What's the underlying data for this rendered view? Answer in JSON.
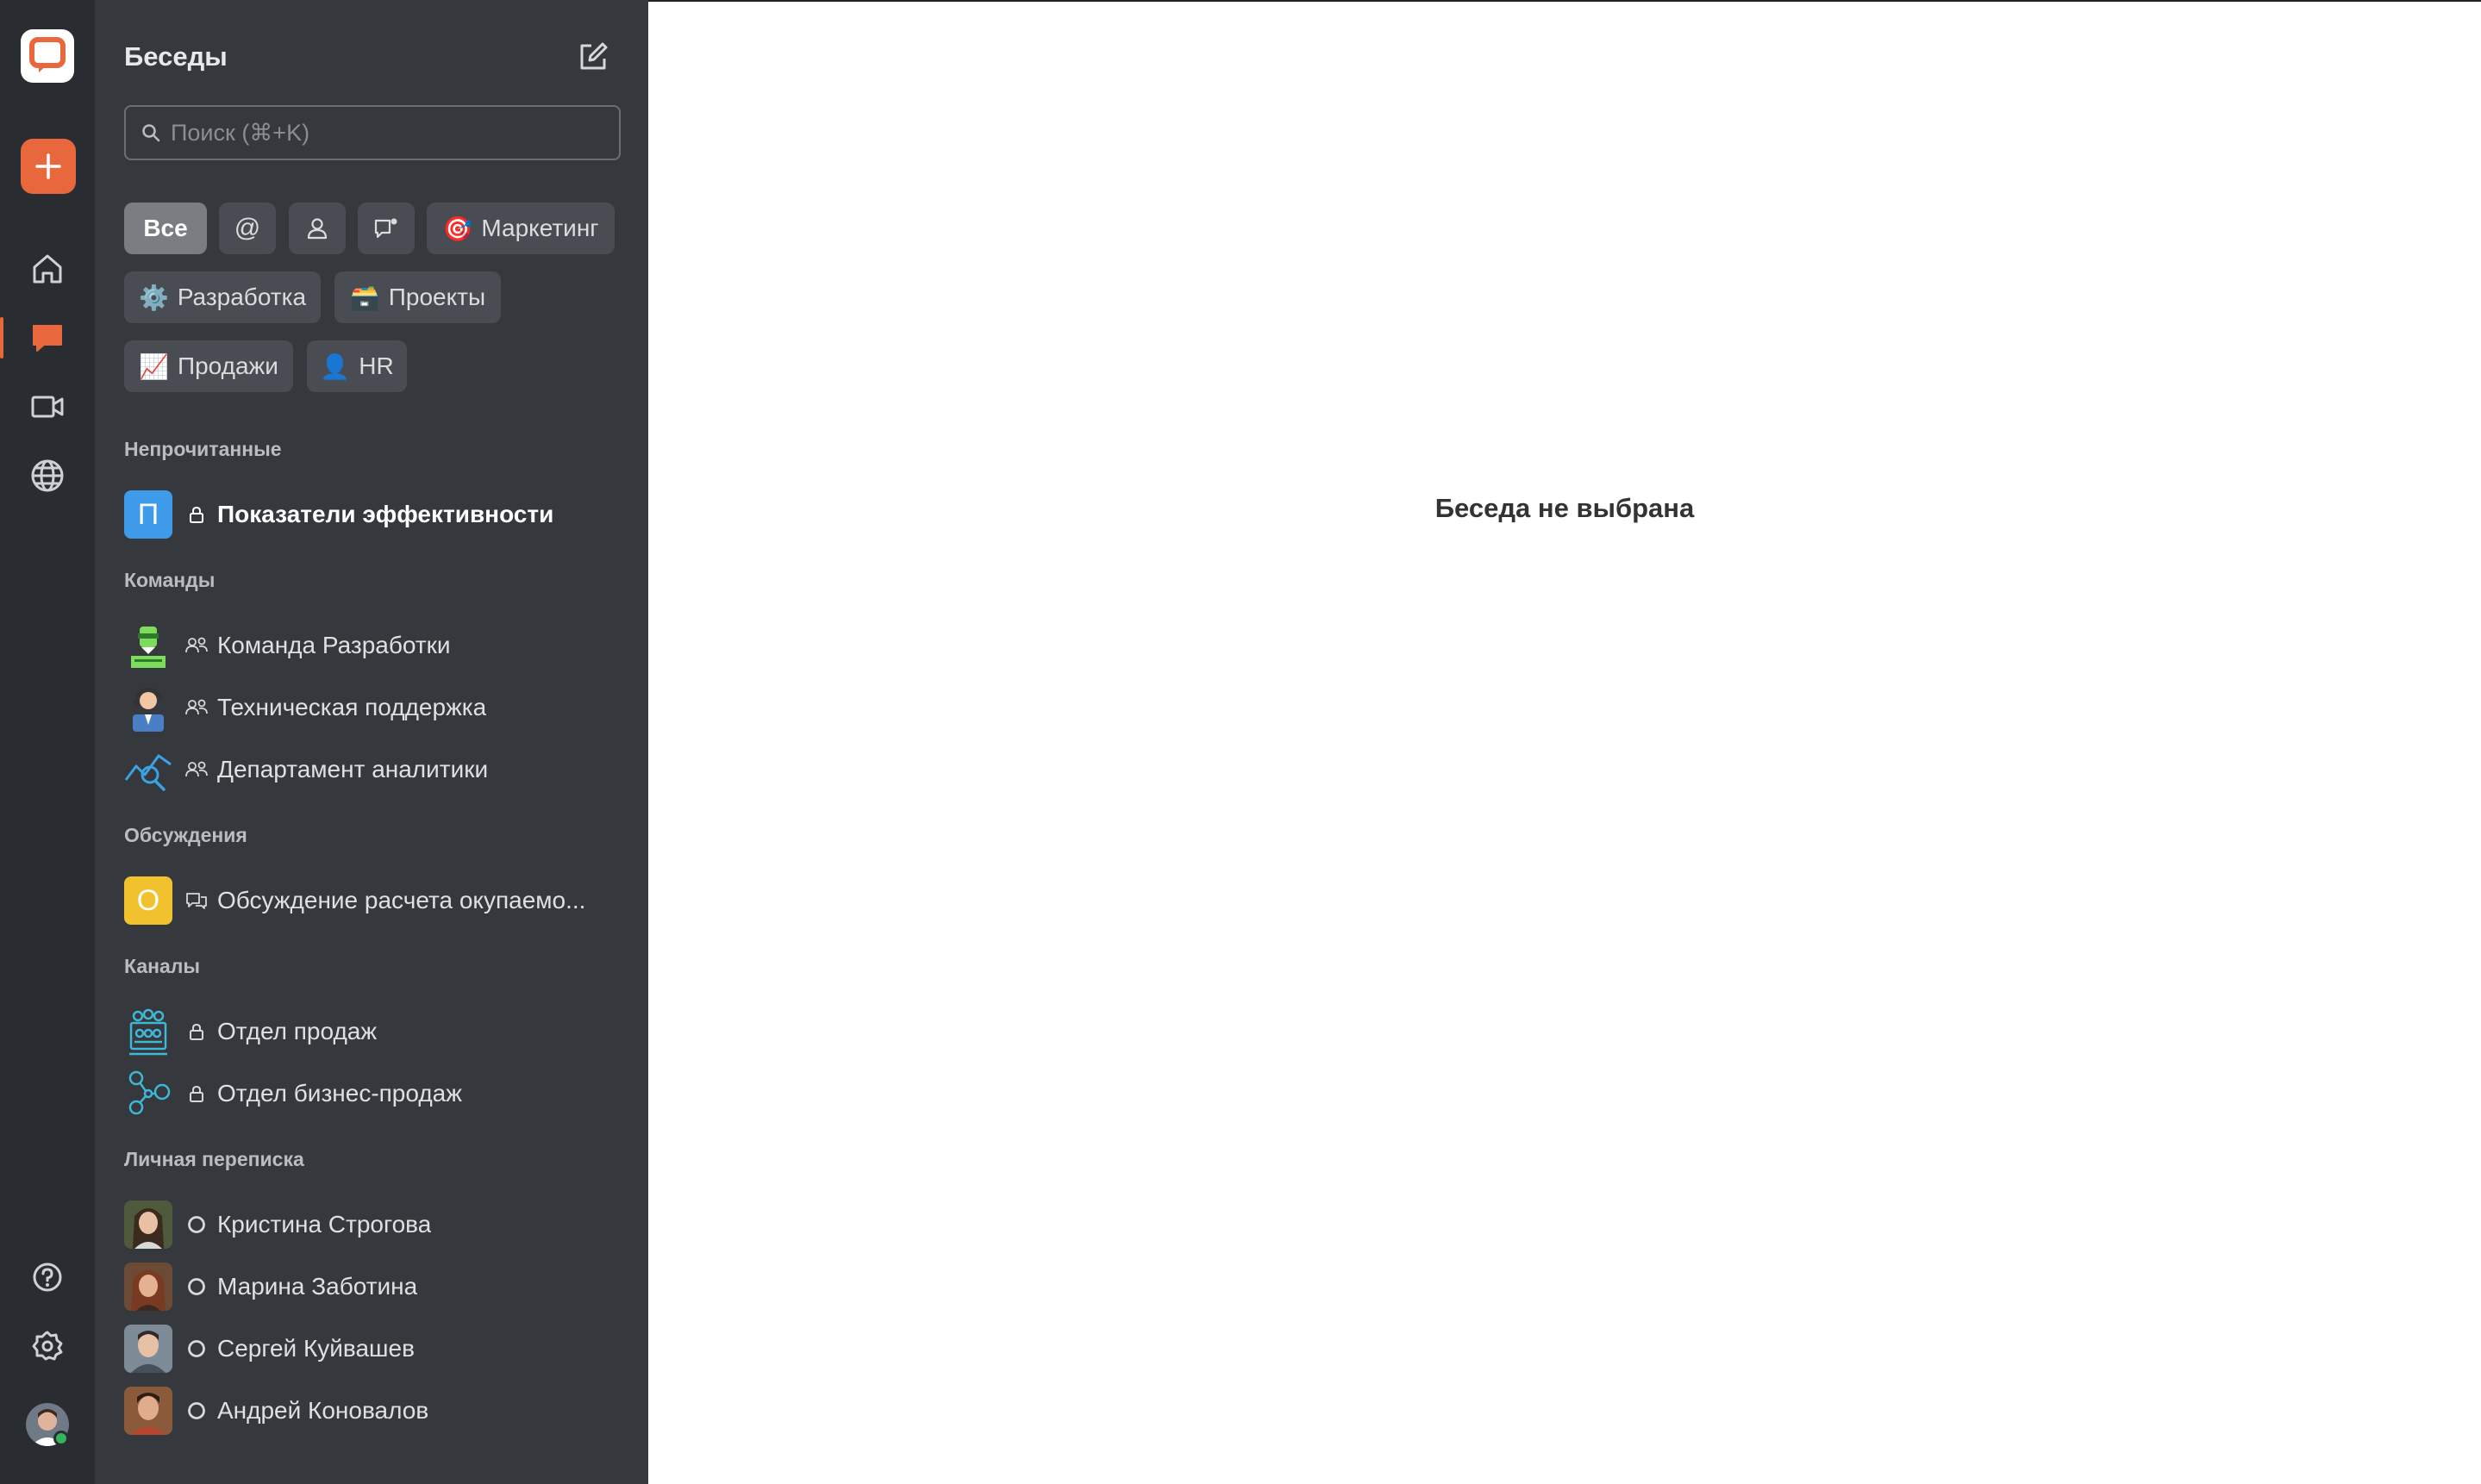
{
  "sidebar": {
    "title": "Беседы",
    "search_placeholder": "Поиск (⌘+K)",
    "filters": {
      "all": "Все",
      "marketing": "Маркетинг",
      "development": "Разработка",
      "projects": "Проекты",
      "sales": "Продажи",
      "hr": "HR"
    },
    "sections": {
      "unread": {
        "title": "Непрочитанные",
        "items": [
          {
            "label": "Показатели эффективности",
            "avatar_letter": "П",
            "avatar_color": "#3d9be9"
          }
        ]
      },
      "teams": {
        "title": "Команды",
        "items": [
          {
            "label": "Команда Разработки"
          },
          {
            "label": "Техническая поддержка"
          },
          {
            "label": "Департамент аналитики"
          }
        ]
      },
      "discussions": {
        "title": "Обсуждения",
        "items": [
          {
            "label": "Обсуждение расчета окупаемо...",
            "avatar_letter": "О",
            "avatar_color": "#f2c12e"
          }
        ]
      },
      "channels": {
        "title": "Каналы",
        "items": [
          {
            "label": "Отдел продаж"
          },
          {
            "label": "Отдел бизнес-продаж"
          }
        ]
      },
      "direct": {
        "title": "Личная переписка",
        "items": [
          {
            "label": "Кристина Строгова"
          },
          {
            "label": "Марина Заботина"
          },
          {
            "label": "Сергей Куйвашев"
          },
          {
            "label": "Андрей Коновалов"
          }
        ]
      }
    }
  },
  "main": {
    "empty_text": "Беседа не выбрана"
  },
  "colors": {
    "rail_bg": "#292c30",
    "sidebar_bg": "#35383d",
    "accent": "#e8673c",
    "online": "#34b35a"
  }
}
